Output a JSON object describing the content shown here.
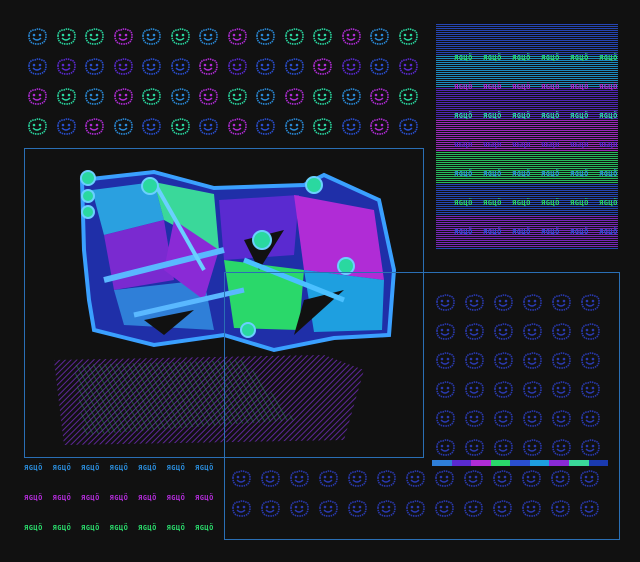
{
  "artwork": {
    "tag_text": "ЯGЦÖ",
    "palette": [
      "#2f7fd8",
      "#5a2ad0",
      "#b02cd6",
      "#2ad86a",
      "#2a4fd0",
      "#1e9fe0",
      "#8a2ad6",
      "#3ad89a",
      "#1a3ab0"
    ],
    "smiley_icon": "smiley-face-icon",
    "graffiti_piece": "graffiti-throwup"
  }
}
